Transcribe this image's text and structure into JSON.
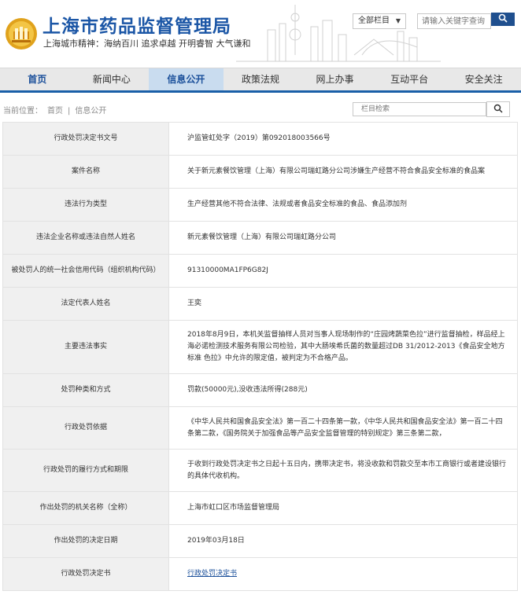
{
  "header": {
    "title": "上海市药品监督管理局",
    "slogan": "上海城市精神：海纳百川  追求卓越  开明睿智  大气谦和",
    "scope_select": "全部栏目",
    "keyword_placeholder": "请输入关键字查询"
  },
  "nav": {
    "items": [
      "首页",
      "新闻中心",
      "信息公开",
      "政策法规",
      "网上办事",
      "互动平台",
      "安全关注"
    ]
  },
  "breadcrumb": {
    "label": "当前位置：",
    "home": "首页",
    "current": "信息公开"
  },
  "column_search": {
    "placeholder": "栏目检索"
  },
  "record": {
    "rows": [
      {
        "label": "行政处罚决定书文号",
        "value": "沪监管虹处字（2019）第092018003566号"
      },
      {
        "label": "案件名称",
        "value": "关于新元素餐饮管理（上海）有限公司瑞虹路分公司涉嫌生产经营不符合食品安全标准的食品案"
      },
      {
        "label": "违法行为类型",
        "value": "生产经营其他不符合法律、法规或者食品安全标准的食品、食品添加剂"
      },
      {
        "label": "违法企业名称或违法自然人姓名",
        "value": "新元素餐饮管理（上海）有限公司瑞虹路分公司"
      },
      {
        "label": "被处罚人的统一社会信用代码（组织机构代码）",
        "value": "91310000MA1FP6G82J"
      },
      {
        "label": "法定代表人姓名",
        "value": "王奕"
      },
      {
        "label": "主要违法事实",
        "value": "2018年8月9日，本机关监督抽样人员对当事人现场制作的“庄园烤蔬菜色拉”进行监督抽检，样品经上海必诺检测技术服务有限公司检验，其中大肠埃希氏菌的数量超过DB 31/2012-2013《食品安全地方标准 色拉》中允许的限定值，被判定为不合格产品。"
      },
      {
        "label": "处罚种类和方式",
        "value": "罚款(50000元),没收违法所得(288元)"
      },
      {
        "label": "行政处罚依据",
        "value": "《中华人民共和国食品安全法》第一百二十四条第一款，《中华人民共和国食品安全法》第一百二十四条第二款，《国务院关于加强食品等产品安全监督管理的特别规定》第三条第二款，"
      },
      {
        "label": "行政处罚的履行方式和期限",
        "value": "于收到行政处罚决定书之日起十五日内，携带决定书，将没收款和罚款交至本市工商银行或者建设银行的具体代收机构。"
      },
      {
        "label": "作出处罚的机关名称（全称）",
        "value": "上海市虹口区市场监督管理局"
      },
      {
        "label": "作出处罚的决定日期",
        "value": "2019年03月18日"
      },
      {
        "label": "行政处罚决定书",
        "value": "行政处罚决定书"
      }
    ]
  },
  "colors": {
    "brand_blue": "#1b56a6",
    "nav_active_bg": "#c9dcef",
    "label_bg": "#f0f0f0"
  },
  "icons": {
    "logo": "emblem-logo",
    "keyword_search": "search-icon",
    "column_search": "magnifier-icon"
  }
}
